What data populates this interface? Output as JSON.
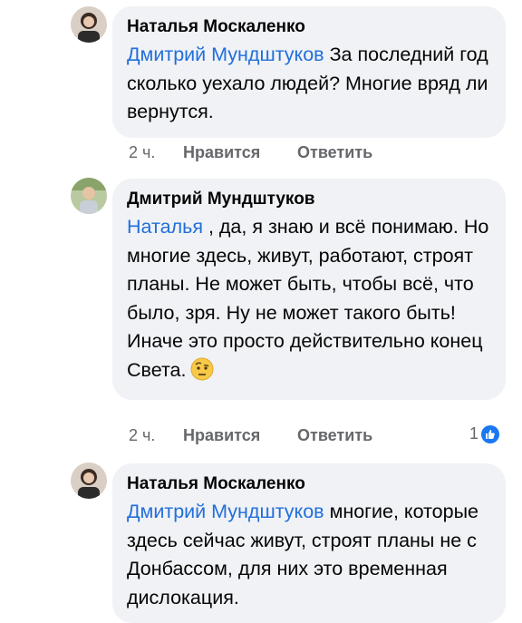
{
  "comments": [
    {
      "author": "Наталья Москаленко",
      "mention": "Дмитрий Мундштуков",
      "text": " За последний год сколько уехало людей? Многие вряд ли вернутся.",
      "time": "2 ч.",
      "like_label": "Нравится",
      "reply_label": "Ответить"
    },
    {
      "author": "Дмитрий Мундштуков",
      "mention": "Наталья",
      "text": " , да, я знаю и всё понимаю. Но многие здесь, живут, работают, строят планы. Не может быть, чтобы всё, что было, зря. Ну не может такого быть! Иначе это просто действительно конец Света.",
      "emoji": "face-with-raised-eyebrow-emoji",
      "time": "2 ч.",
      "like_label": "Нравится",
      "reply_label": "Ответить",
      "reaction_count": "1",
      "reaction_icon": "like-icon"
    },
    {
      "author": "Наталья Москаленко",
      "mention": "Дмитрий Мундштуков",
      "text": " многие, которые здесь сейчас живут, строят планы не с Донбассом, для них это временная дислокация."
    }
  ],
  "colors": {
    "bubble": "#f0f2f5",
    "mention": "#216fdb",
    "secondary_text": "#65676b",
    "like_blue": "#1877f2"
  }
}
